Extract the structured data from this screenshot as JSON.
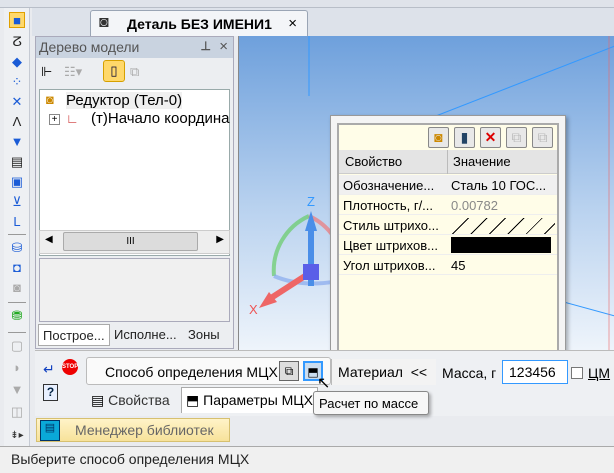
{
  "document": {
    "tab_title": "Деталь БЕЗ ИМЕНИ1",
    "close": "×"
  },
  "tree": {
    "title": "Дерево модели",
    "pin": "⊥",
    "close": "×",
    "root": "Редуктор (Тел-0)",
    "child": "(т)Начало координа",
    "expand": "+",
    "tabs": [
      "Построе...",
      "Исполне...",
      "Зоны"
    ]
  },
  "viewport": {
    "axis_z": "Z",
    "axis_x": "X"
  },
  "popup": {
    "columns": [
      "Свойство",
      "Значение"
    ],
    "rows": [
      {
        "prop": "Обозначение...",
        "value": "Сталь 10  ГОС..."
      },
      {
        "prop": "Плотность, г/...",
        "value": "0.00782"
      },
      {
        "prop": "Стиль штрихо...",
        "value": "////// "
      },
      {
        "prop": "Цвет штрихов...",
        "value": ""
      },
      {
        "prop": "Угол штрихов...",
        "value": "45"
      }
    ],
    "hatch_color": "#000000"
  },
  "propbar": {
    "method_label": "Способ определения МЦХ",
    "material_label": "Материал",
    "collapse": "<<",
    "mass_label": "Масса, г",
    "mass_value": "123456",
    "cm_label": "ЦМ",
    "cm_checked": false,
    "tabs": [
      "Свойства",
      "Параметры МЦХ"
    ],
    "stop": "STOP",
    "help": "?"
  },
  "tooltip": "Расчет по массе",
  "library_manager": "Менеджер библиотек",
  "status": "Выберите способ определения МЦХ"
}
